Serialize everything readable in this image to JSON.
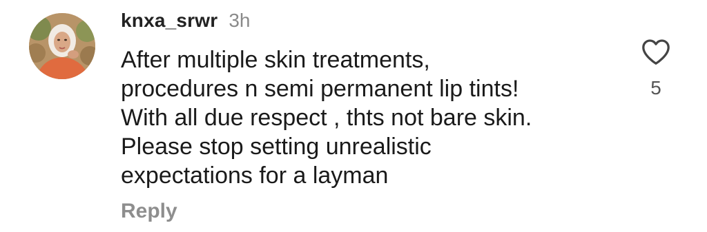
{
  "comment": {
    "username": "knxa_srwr",
    "timestamp": "3h",
    "text_lines": [
      "After multiple skin treatments,",
      "procedures n semi permanent lip tints!",
      "With all due respect , thts not bare skin.",
      "Please stop setting unrealistic",
      "expectations for a layman"
    ],
    "reply_label": "Reply",
    "like_count": "5",
    "like_icon": "heart-outline-icon",
    "colors": {
      "username": "#222222",
      "timestamp": "#8a8a8a",
      "text": "#1a1a1a",
      "reply": "#8e8e8e",
      "like_count": "#555555",
      "icon_stroke": "#444444"
    }
  }
}
